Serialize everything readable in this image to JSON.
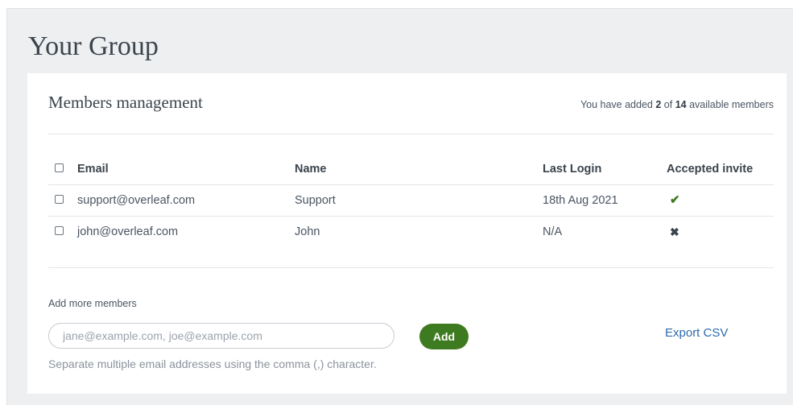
{
  "page": {
    "title": "Your Group"
  },
  "members": {
    "heading": "Members management",
    "counter": {
      "prefix": "You have added",
      "added": "2",
      "of": "of",
      "available": "14",
      "suffix": "available members"
    },
    "columns": {
      "email": "Email",
      "name": "Name",
      "last_login": "Last Login",
      "accepted": "Accepted invite"
    },
    "rows": [
      {
        "email": "support@overleaf.com",
        "name": "Support",
        "last_login": "18th Aug 2021",
        "accepted": true,
        "accepted_icon": "✔"
      },
      {
        "email": "john@overleaf.com",
        "name": "John",
        "last_login": "N/A",
        "accepted": false,
        "accepted_icon": "✖"
      }
    ]
  },
  "add_members": {
    "label": "Add more members",
    "placeholder": "jane@example.com, joe@example.com",
    "value": "",
    "add_label": "Add",
    "export_label": "Export CSV",
    "help": "Separate multiple email addresses using the comma (,) character."
  },
  "colors": {
    "accent_green": "#3e7a1f",
    "link_blue": "#2f6aad",
    "background": "#eeeff1"
  }
}
